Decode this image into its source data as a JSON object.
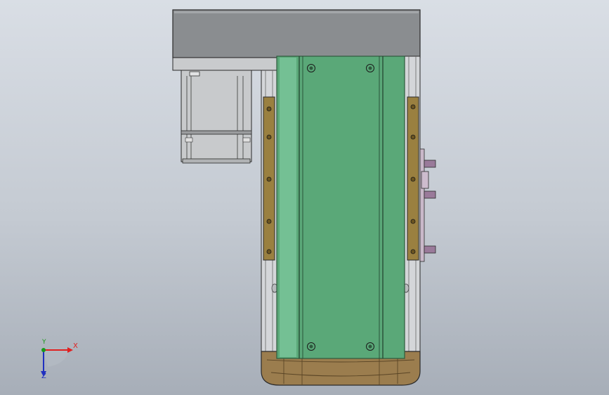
{
  "viewport": {
    "background_top": "#d9dee5",
    "background_bottom": "#a7aeb8"
  },
  "colors": {
    "motor_cover": "#8a8d90",
    "slide_plate": "#5aa878",
    "slide_plate_edge": "#2d5a3d",
    "rail_bar": "#9a8040",
    "end_cap": "#9b7d4e",
    "frame_rail": "#d4d6d9",
    "motor_body": "#c8cacc",
    "bracket": "#9a7a9a"
  },
  "triad": {
    "x_label": "X",
    "y_label": "Y",
    "z_label": "Z",
    "x_color": "#e02020",
    "y_color": "#1a9a1a",
    "z_color": "#2030c0"
  }
}
